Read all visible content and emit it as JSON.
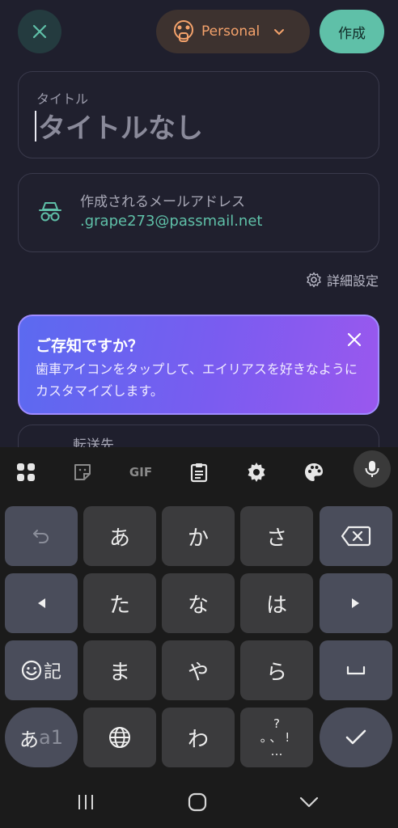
{
  "header": {
    "account_label": "Personal",
    "create_label": "作成"
  },
  "title_field": {
    "label": "タイトル",
    "value": "タイトルなし"
  },
  "email_field": {
    "label": "作成されるメールアドレス",
    "value": ".grape273@passmail.net"
  },
  "advanced_label": "詳細設定",
  "tip": {
    "title": "ご存知ですか？",
    "body": "歯車アイコンをタップして、エイリアスを好きなようにカスタマイズします。"
  },
  "peek_label": "転送先",
  "keyboard": {
    "toolbar": {
      "gif_label": "GIF"
    },
    "keys": {
      "a": "あ",
      "ka": "か",
      "sa": "さ",
      "ta": "た",
      "na": "な",
      "ha": "は",
      "ma": "ま",
      "ya": "や",
      "ra": "ら",
      "wa": "わ",
      "emoji_label": "記",
      "mode_label_1": "あ",
      "mode_label_2": "a1",
      "punct_top": "?",
      "punct_mid": "。、!",
      "punct_bottom": "…"
    }
  },
  "colors": {
    "accent": "#5fc0a8",
    "account": "#f4a26b",
    "tip_gradient_start": "#5b6af0",
    "tip_gradient_end": "#9a58ee"
  }
}
